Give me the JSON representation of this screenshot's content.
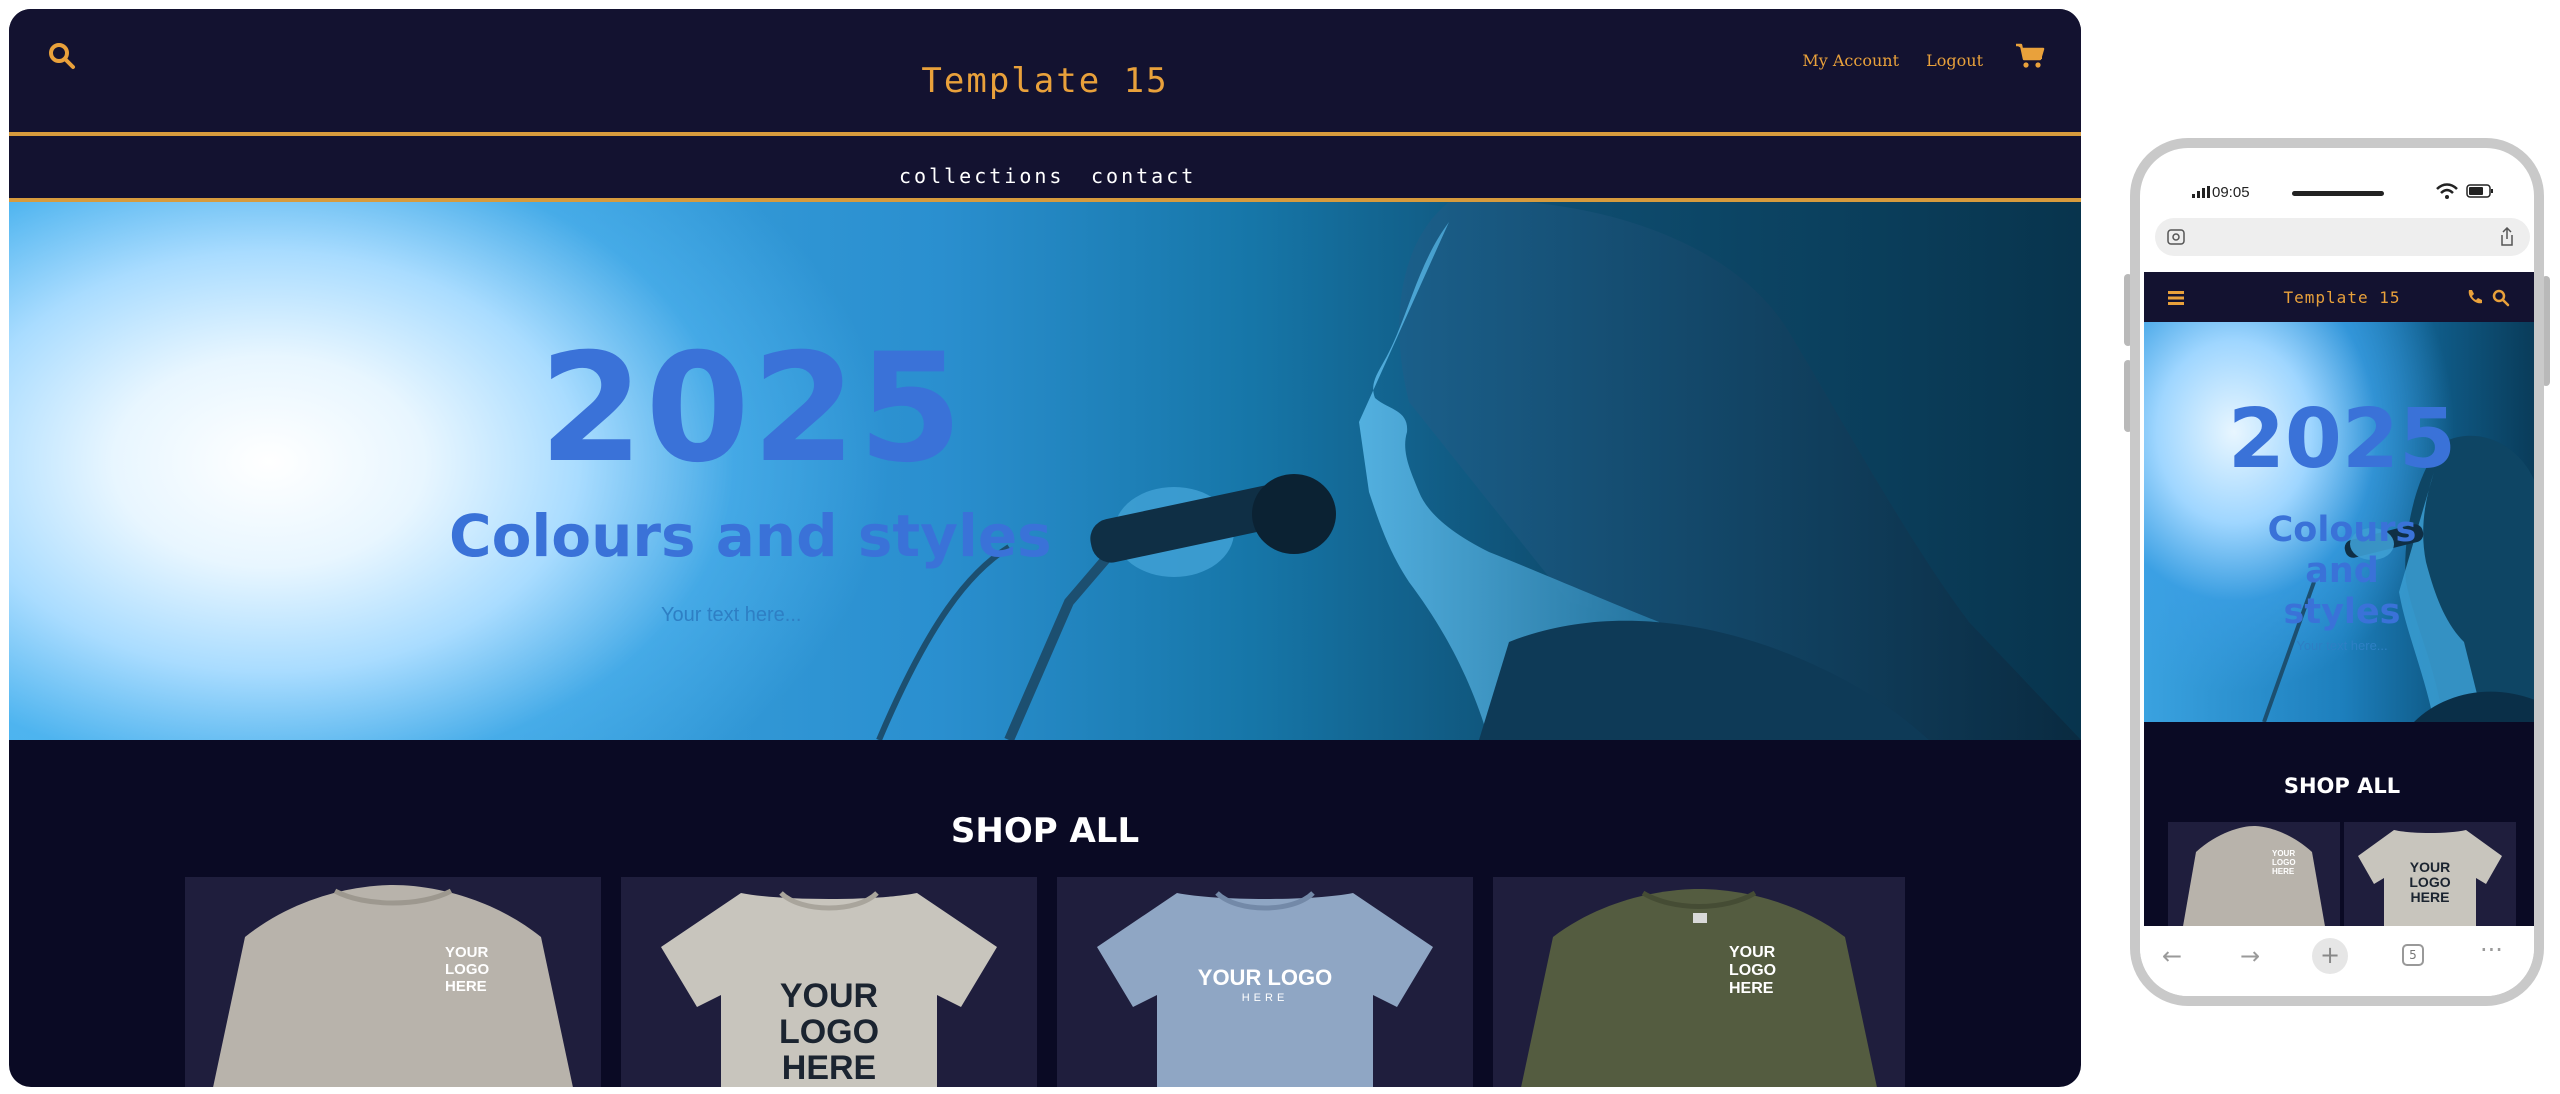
{
  "desktop": {
    "brand": "Template 15",
    "account_link": "My Account",
    "logout_link": "Logout",
    "nav": [
      "collections",
      "contact"
    ],
    "hero": {
      "year": "2025",
      "title": "Colours and styles",
      "subtitle": "Your text here..."
    },
    "shop_title": "SHOP ALL",
    "products": [
      {
        "logo_text": "YOUR\nLOGO\nHERE",
        "color": "#b8b3ab",
        "style": "longsleeve"
      },
      {
        "logo_text": "YOUR\nLOGO\nHERE",
        "color": "#c8c5bd",
        "style": "tshirt"
      },
      {
        "logo_text": "YOUR LOGO",
        "logo_sub": "HERE",
        "color": "#8fa6c4",
        "style": "tshirt"
      },
      {
        "logo_text": "YOUR\nLOGO\nHERE",
        "color": "#545c40",
        "style": "longsleeve"
      }
    ],
    "colors": {
      "accent": "#e9a13b",
      "header_bg": "#131230",
      "page_bg": "#0a0a24",
      "hero_text": "#3a72d8"
    }
  },
  "phone": {
    "status_time": "09:05",
    "brand": "Template 15",
    "hero": {
      "year": "2025",
      "title": "Colours\nand\nstyles",
      "subtitle": "Your text here..."
    },
    "shop_title": "SHOP ALL",
    "tab_count": "5"
  },
  "icons": [
    "search-icon",
    "cart-icon",
    "menu-icon",
    "phone-icon",
    "share-icon",
    "back-icon",
    "forward-icon",
    "new-tab-icon",
    "tabs-icon",
    "more-icon",
    "wifi-icon",
    "battery-icon",
    "signal-icon"
  ]
}
